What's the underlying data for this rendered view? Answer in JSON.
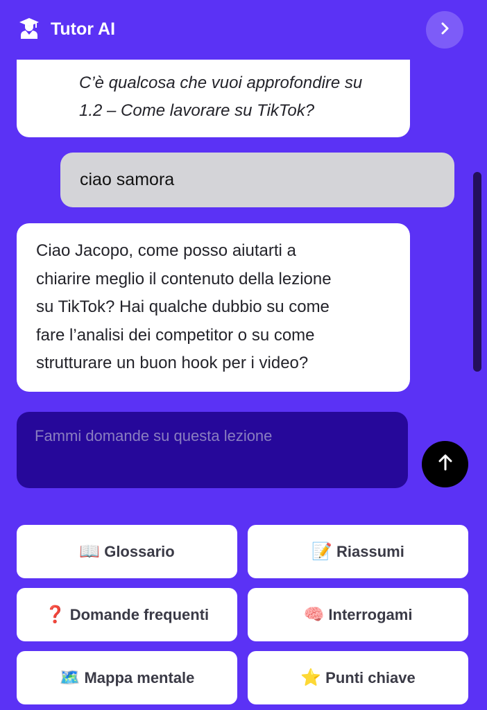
{
  "header": {
    "title": "Tutor AI",
    "logo_icon": "graduate-icon",
    "next_icon": "chevron-right-icon"
  },
  "messages": [
    {
      "role": "assistant",
      "lines": [
        "C’è qualcosa che vuoi approfondire su",
        "1.2 – Come lavorare su TikTok?"
      ]
    },
    {
      "role": "user",
      "text": "ciao samora"
    },
    {
      "role": "assistant",
      "lines": [
        "Ciao Jacopo, come posso aiutarti a",
        "chiarire meglio il contenuto della lezione",
        "su TikTok? Hai qualche dubbio su come",
        "fare l’analisi dei competitor o su come",
        "strutturare un buon hook per i video?"
      ]
    }
  ],
  "composer": {
    "placeholder": "Fammi domande su questa lezione",
    "send_icon": "arrow-up-icon"
  },
  "actions": [
    {
      "emoji": "📖",
      "label": "Glossario"
    },
    {
      "emoji": "📝",
      "label": "Riassumi"
    },
    {
      "emoji": "❓",
      "label": "Domande frequenti"
    },
    {
      "emoji": "🧠",
      "label": "Interrogami"
    },
    {
      "emoji": "🗺️",
      "label": "Mappa mentale"
    },
    {
      "emoji": "⭐",
      "label": "Punti chiave"
    }
  ],
  "colors": {
    "background": "#5b32f5",
    "composer": "#26089a",
    "user_bubble": "#d4d4d8",
    "assistant_bubble": "#ffffff",
    "send_button": "#000000"
  }
}
